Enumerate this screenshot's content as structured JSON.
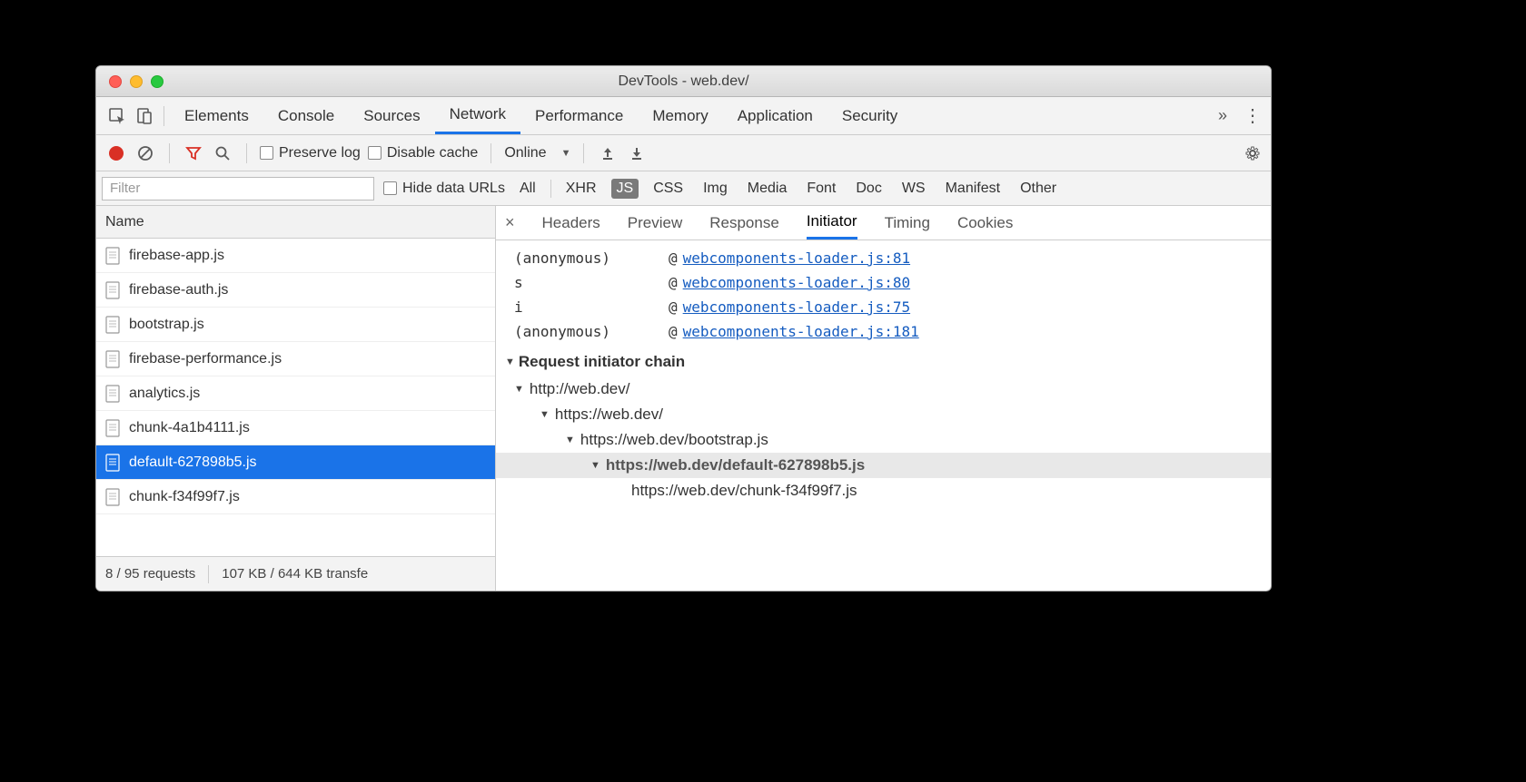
{
  "window_title": "DevTools - web.dev/",
  "main_tabs": [
    "Elements",
    "Console",
    "Sources",
    "Network",
    "Performance",
    "Memory",
    "Application",
    "Security"
  ],
  "main_tab_active": 3,
  "toolbar": {
    "preserve_log": "Preserve log",
    "disable_cache": "Disable cache",
    "throttle": "Online"
  },
  "filter": {
    "placeholder": "Filter",
    "hide_data_urls": "Hide data URLs",
    "types": [
      "All",
      "XHR",
      "JS",
      "CSS",
      "Img",
      "Media",
      "Font",
      "Doc",
      "WS",
      "Manifest",
      "Other"
    ],
    "type_active": 2
  },
  "col_header": "Name",
  "requests": [
    "firebase-app.js",
    "firebase-auth.js",
    "bootstrap.js",
    "firebase-performance.js",
    "analytics.js",
    "chunk-4a1b4111.js",
    "default-627898b5.js",
    "chunk-f34f99f7.js"
  ],
  "request_selected": 6,
  "status": {
    "requests": "8 / 95 requests",
    "transfer": "107 KB / 644 KB transfe"
  },
  "detail_tabs": [
    "Headers",
    "Preview",
    "Response",
    "Initiator",
    "Timing",
    "Cookies"
  ],
  "detail_tab_active": 3,
  "stack": [
    {
      "fn": "(anonymous)",
      "link": "webcomponents-loader.js:81"
    },
    {
      "fn": "s",
      "link": "webcomponents-loader.js:80"
    },
    {
      "fn": "i",
      "link": "webcomponents-loader.js:75"
    },
    {
      "fn": "(anonymous)",
      "link": "webcomponents-loader.js:181"
    }
  ],
  "chain_header": "Request initiator chain",
  "chain": [
    {
      "url": "http://web.dev/",
      "indent": 0,
      "expand": true,
      "current": false
    },
    {
      "url": "https://web.dev/",
      "indent": 1,
      "expand": true,
      "current": false
    },
    {
      "url": "https://web.dev/bootstrap.js",
      "indent": 2,
      "expand": true,
      "current": false
    },
    {
      "url": "https://web.dev/default-627898b5.js",
      "indent": 3,
      "expand": true,
      "current": true
    },
    {
      "url": "https://web.dev/chunk-f34f99f7.js",
      "indent": 4,
      "expand": false,
      "current": false
    }
  ]
}
